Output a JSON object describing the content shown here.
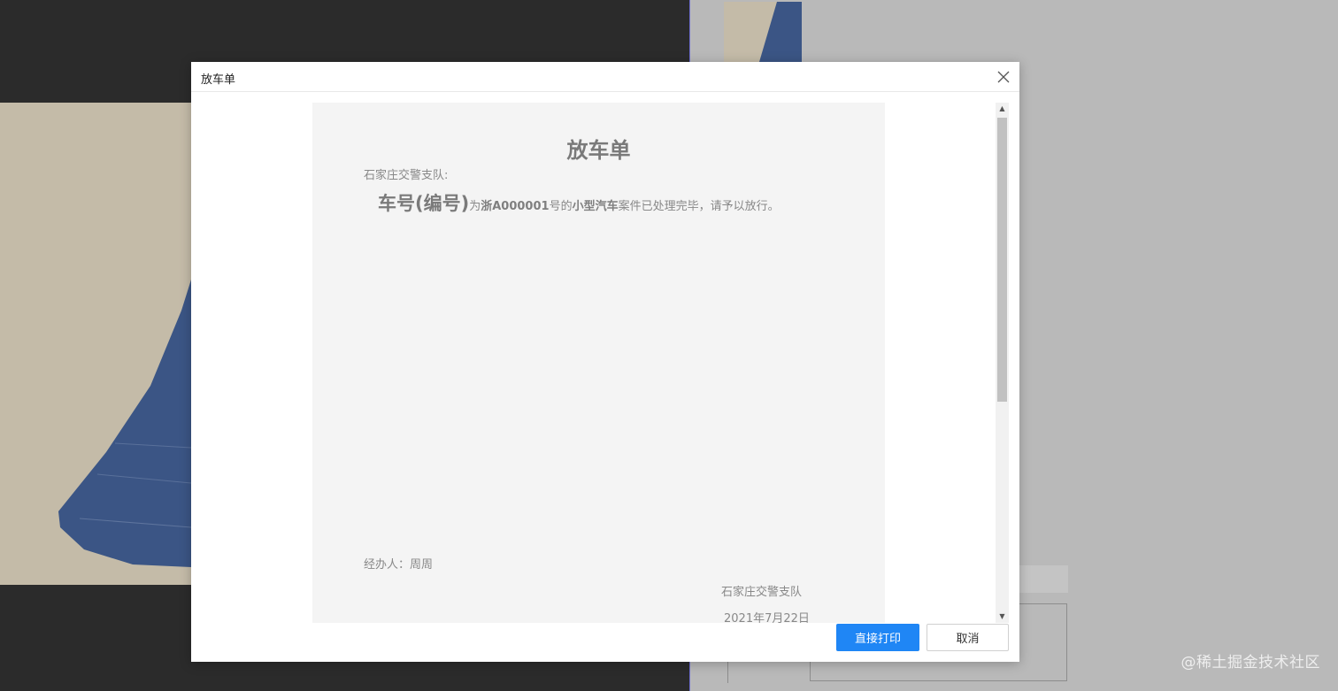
{
  "modal": {
    "title": "放车单",
    "close_icon": "close-icon"
  },
  "document": {
    "title": "放车单",
    "addressee": "石家庄交警支队:",
    "body": {
      "vehicle_label": "车号(编号)",
      "prefix": "为",
      "plate": "浙A000001",
      "middle": "号的",
      "vehicle_type": "小型汽车",
      "suffix": "案件已处理完毕，请予以放行。"
    },
    "handler": "经办人：周周",
    "issuer": "石家庄交警支队",
    "date": "2021年7月22日"
  },
  "footer": {
    "print_label": "直接打印",
    "cancel_label": "取消"
  },
  "watermark": "@稀土掘金技术社区",
  "colors": {
    "primary": "#1f86f5",
    "overlay_dark": "#2b2b2b",
    "overlay_light": "#b9b9b9",
    "paper": "#f4f4f4"
  }
}
